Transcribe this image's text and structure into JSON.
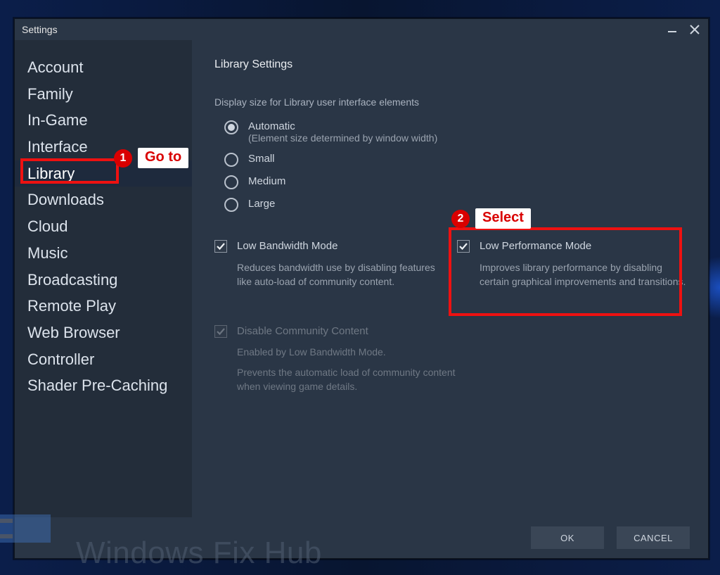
{
  "titlebar": {
    "title": "Settings"
  },
  "sidebar": {
    "items": [
      {
        "label": "Account"
      },
      {
        "label": "Family"
      },
      {
        "label": "In-Game"
      },
      {
        "label": "Interface"
      },
      {
        "label": "Library",
        "active": true
      },
      {
        "label": "Downloads"
      },
      {
        "label": "Cloud"
      },
      {
        "label": "Music"
      },
      {
        "label": "Broadcasting"
      },
      {
        "label": "Remote Play"
      },
      {
        "label": "Web Browser"
      },
      {
        "label": "Controller"
      },
      {
        "label": "Shader Pre-Caching"
      }
    ]
  },
  "main": {
    "panel_title": "Library Settings",
    "display_size": {
      "label": "Display size for Library user interface elements",
      "options": {
        "automatic": {
          "label": "Automatic",
          "sub": "(Element size determined by window width)"
        },
        "small": {
          "label": "Small"
        },
        "medium": {
          "label": "Medium"
        },
        "large": {
          "label": "Large"
        }
      }
    },
    "low_bandwidth": {
      "label": "Low Bandwidth Mode",
      "desc": "Reduces bandwidth use by disabling features like auto-load of community content."
    },
    "low_performance": {
      "label": "Low Performance Mode",
      "desc": "Improves library performance by disabling certain graphical improvements and transitions."
    },
    "disable_community": {
      "label": "Disable Community Content",
      "note": "Enabled by Low Bandwidth Mode.",
      "desc": "Prevents the automatic load of community content when viewing game details."
    }
  },
  "footer": {
    "ok": "OK",
    "cancel": "CANCEL"
  },
  "callouts": {
    "c1": "Go to",
    "c2": "Select",
    "n1": "1",
    "n2": "2"
  },
  "watermark": "Windows Fix Hub"
}
